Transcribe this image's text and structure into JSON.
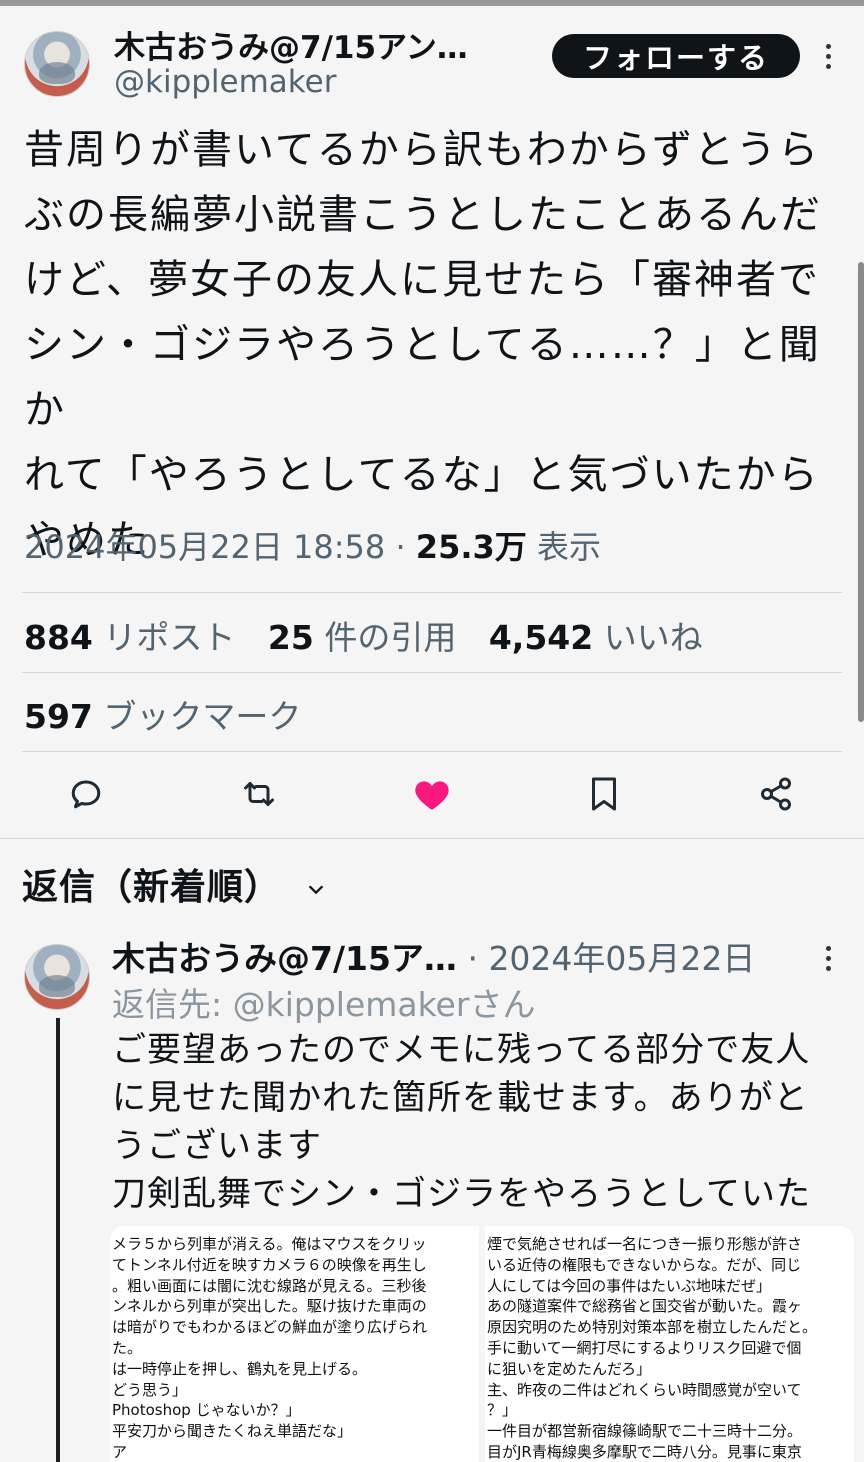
{
  "tweet": {
    "author_name": "木古おうみ@7/15アン…",
    "handle": "@kipplemaker",
    "follow_label": "フォローする",
    "text_lines": [
      "昔周りが書いてるから訳もわからずとうら",
      "ぶの長編夢小説書こうとしたことあるんだ",
      "けど、夢女子の友人に見せたら「審神者で",
      "シン・ゴジラやろうとしてる……？」と聞か",
      "れて「やろうとしてるな」と気づいたから",
      "やめた"
    ],
    "timestamp": "2024年05月22日 18:58",
    "separator": "·",
    "views_count": "25.3万",
    "views_label": "表示"
  },
  "stats": {
    "reposts_count": "884",
    "reposts_label": "リポスト",
    "quotes_count": "25",
    "quotes_label": "件の引用",
    "likes_count": "4,542",
    "likes_label": "いいね",
    "bookmarks_count": "597",
    "bookmarks_label": "ブックマーク"
  },
  "actions": {
    "reply_icon": "reply-icon",
    "repost_icon": "repost-icon",
    "like_icon": "heart-filled-icon",
    "bookmark_icon": "bookmark-icon",
    "share_icon": "share-icon",
    "like_color": "#f91880"
  },
  "replies": {
    "header": "返信（新着順）"
  },
  "reply": {
    "author_name": "木古おうみ@7/15ア…",
    "date_prefix": "·",
    "date": "2024年05月22日",
    "reply_to_prefix": "返信先: ",
    "reply_to_handle": "@kipplemaker",
    "reply_to_suffix": "さん",
    "text_lines": [
      "ご要望あったのでメモに残ってる部分で友人",
      "に見せた聞かれた箇所を載せます。ありがと",
      "うございます",
      "刀剣乱舞でシン・ゴジラをやろうとしていた"
    ],
    "media_left": [
      "メラ５から列車が消える。俺はマウスをクリッ",
      "てトンネル付近を映すカメラ６の映像を再生し",
      "。粗い画面には闇に沈む線路が見える。三秒後",
      "ンネルから列車が突出した。駆け抜けた車両の",
      "は暗がりでもわかるほどの鮮血が塗り広げられ",
      "た。",
      "は一時停止を押し、鶴丸を見上げる。",
      "どう思う」",
      "Photoshop じゃないか？」",
      "平安刀から聞きたくねえ単語だな」",
      "ア"
    ],
    "media_right": [
      "煙で気絶させれば一名につき一振り形態が許さ",
      "いる近侍の権限もできないからな。だが、同じ",
      "人にしては今回の事件はたいぶ地味だぜ」",
      "あの隧道案件で総務省と国交省が動いた。霞ヶ",
      "原因究明のため特別対策本部を樹立したんだと。",
      "手に動いて一網打尽にするよりリスク回避で個",
      "に狙いを定めたんだろ」",
      "主、昨夜の二件はどれくらい時間感覚が空いて",
      "？」",
      "一件目が都営新宿線篠崎駅で二十三時十二分。",
      "目がJR青梅線奥多摩駅で二時八分。見事に東京"
    ]
  }
}
